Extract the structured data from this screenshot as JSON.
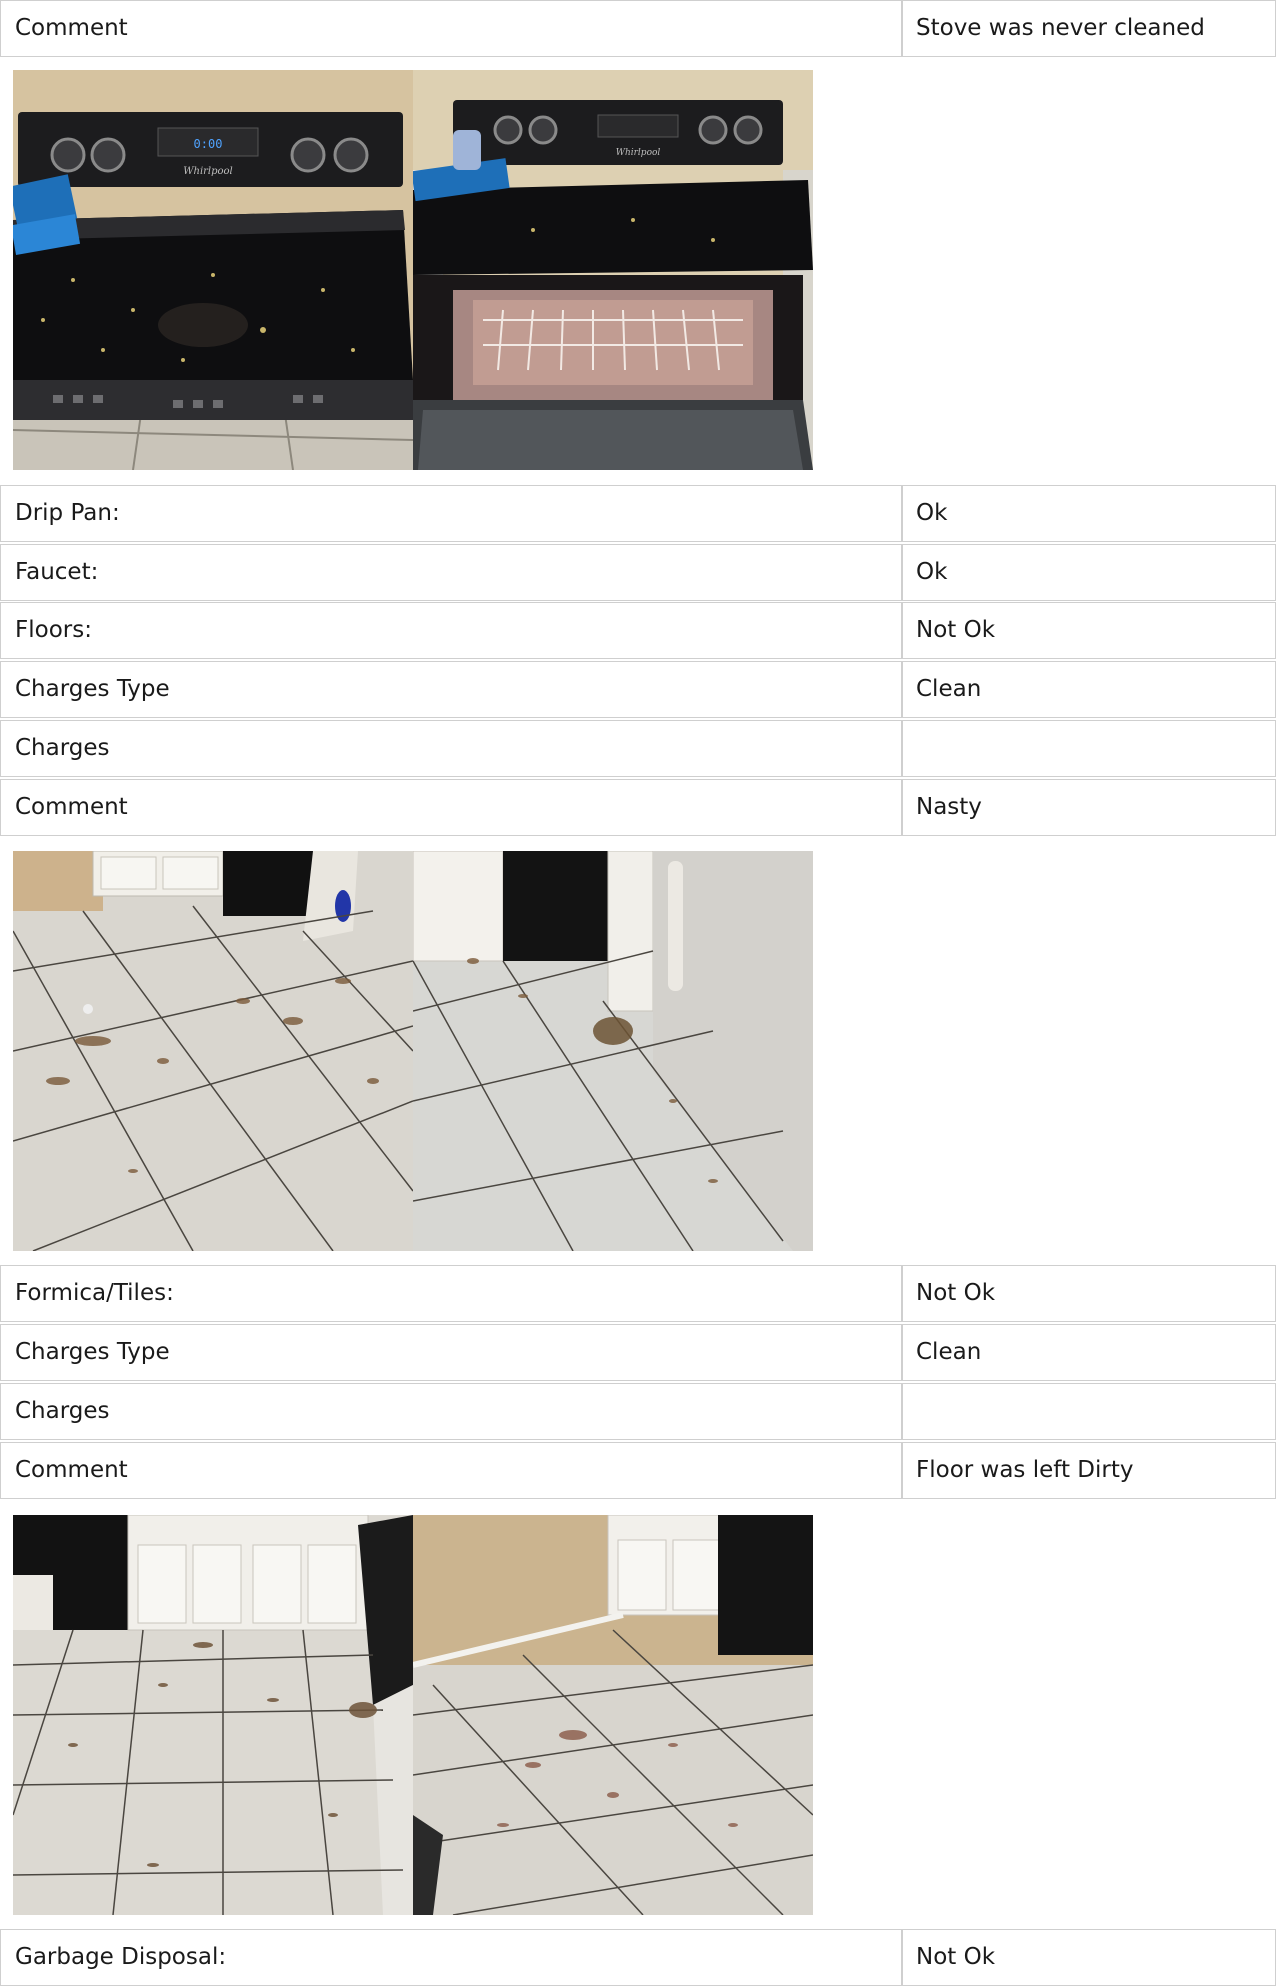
{
  "rows": [
    {
      "label": "Comment",
      "value": "Stove was never cleaned"
    },
    {
      "label": "Drip Pan:",
      "value": "Ok"
    },
    {
      "label": "Faucet:",
      "value": "Ok"
    },
    {
      "label": "Floors:",
      "value": "Not Ok"
    },
    {
      "label": "Charges Type",
      "value": "Clean"
    },
    {
      "label": "Charges",
      "value": ""
    },
    {
      "label": "Comment",
      "value": "Nasty"
    },
    {
      "label": "Formica/Tiles:",
      "value": "Not Ok"
    },
    {
      "label": "Charges Type",
      "value": "Clean"
    },
    {
      "label": "Charges",
      "value": ""
    },
    {
      "label": "Comment",
      "value": "Floor was left Dirty"
    },
    {
      "label": "Garbage Disposal:",
      "value": "Not Ok"
    }
  ],
  "photos": {
    "stove_front": {
      "display": "0:00",
      "brand": "Whirlpool"
    },
    "stove_open": {
      "brand": "Whirlpool"
    }
  }
}
